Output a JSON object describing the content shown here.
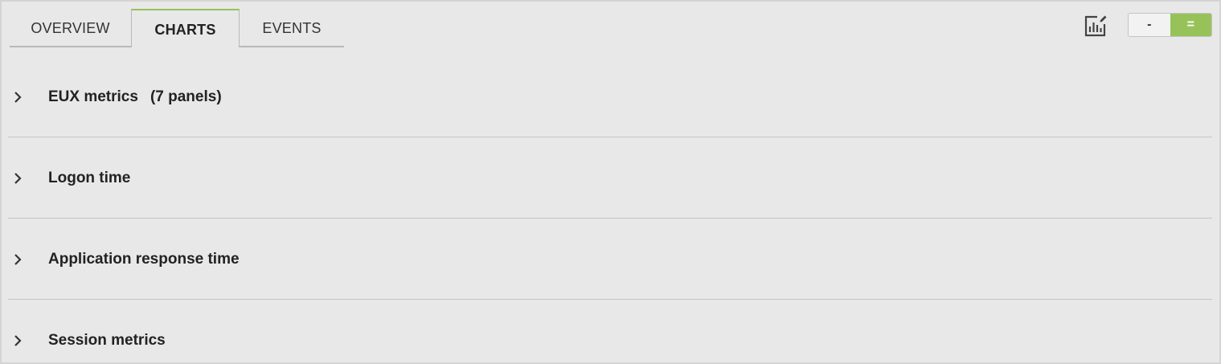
{
  "tabs": {
    "overview": "OVERVIEW",
    "charts": "CHARTS",
    "events": "EVENTS",
    "active": "charts"
  },
  "toolbar": {
    "edit_icon": "edit-chart-icon",
    "collapse_all_label": "-",
    "expand_all_label": "="
  },
  "sections": [
    {
      "title": "EUX metrics",
      "count": "(7 panels)"
    },
    {
      "title": "Logon time",
      "count": ""
    },
    {
      "title": "Application response time",
      "count": ""
    },
    {
      "title": "Session metrics",
      "count": ""
    }
  ],
  "colors": {
    "accent": "#97c25a",
    "background": "#e8e8e8",
    "divider": "#c4c4c4",
    "text": "#222222"
  }
}
